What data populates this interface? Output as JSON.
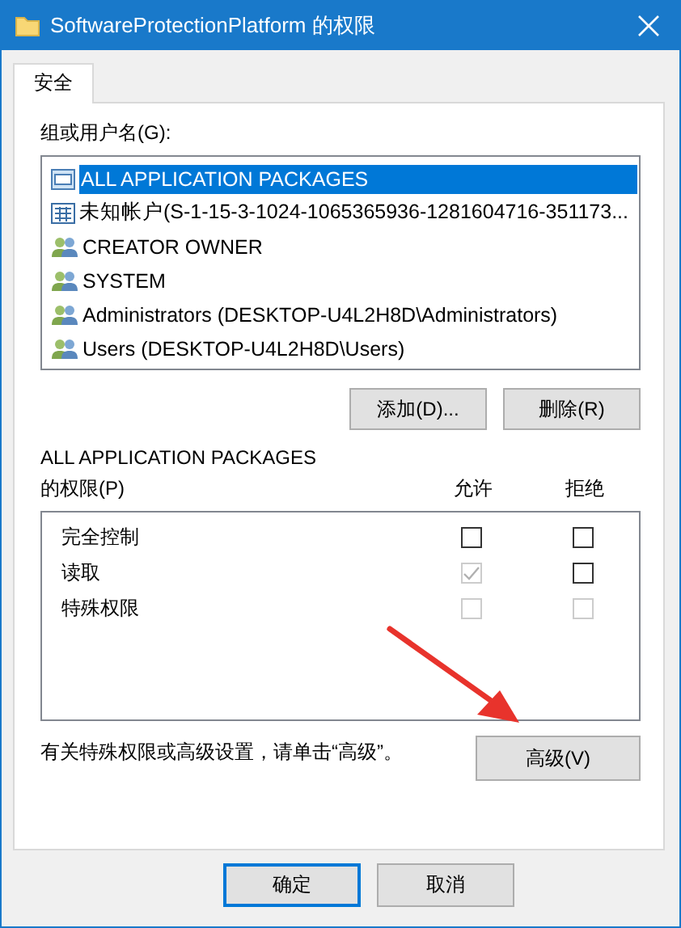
{
  "window": {
    "title": "SoftwareProtectionPlatform 的权限"
  },
  "tabs": [
    {
      "label": "安全",
      "selected": true
    }
  ],
  "group_label": "组或用户名(G):",
  "principals": [
    {
      "name": "ALL APPLICATION PACKAGES",
      "kind": "package",
      "selected": true
    },
    {
      "name": "未知帐户(S-1-15-3-1024-1065365936-1281604716-351173...",
      "kind": "unknown",
      "selected": false
    },
    {
      "name": "CREATOR OWNER",
      "kind": "group",
      "selected": false
    },
    {
      "name": "SYSTEM",
      "kind": "group",
      "selected": false
    },
    {
      "name": "Administrators (DESKTOP-U4L2H8D\\Administrators)",
      "kind": "group",
      "selected": false
    },
    {
      "name": "Users (DESKTOP-U4L2H8D\\Users)",
      "kind": "group",
      "selected": false
    }
  ],
  "list_buttons": [
    "添加(D)...",
    "删除(R)"
  ],
  "permissions_label": {
    "line_1": "ALL APPLICATION PACKAGES",
    "line_2": "的权限(P)"
  },
  "columns": [
    "允许",
    "拒绝"
  ],
  "permissions": [
    {
      "name": "完全控制",
      "allow": {
        "checked": false,
        "disabled": false
      },
      "deny": {
        "checked": false,
        "disabled": false
      }
    },
    {
      "name": "读取",
      "allow": {
        "checked": true,
        "disabled": true
      },
      "deny": {
        "checked": false,
        "disabled": false
      }
    },
    {
      "name": "特殊权限",
      "allow": {
        "checked": false,
        "disabled": true
      },
      "deny": {
        "checked": false,
        "disabled": true
      }
    }
  ],
  "advanced_note": "有关特殊权限或高级设置，请单击“高级”。",
  "advanced_button": "高级(V)",
  "dialog_buttons": [
    {
      "label": "确定",
      "default": true
    },
    {
      "label": "取消",
      "default": false
    }
  ]
}
